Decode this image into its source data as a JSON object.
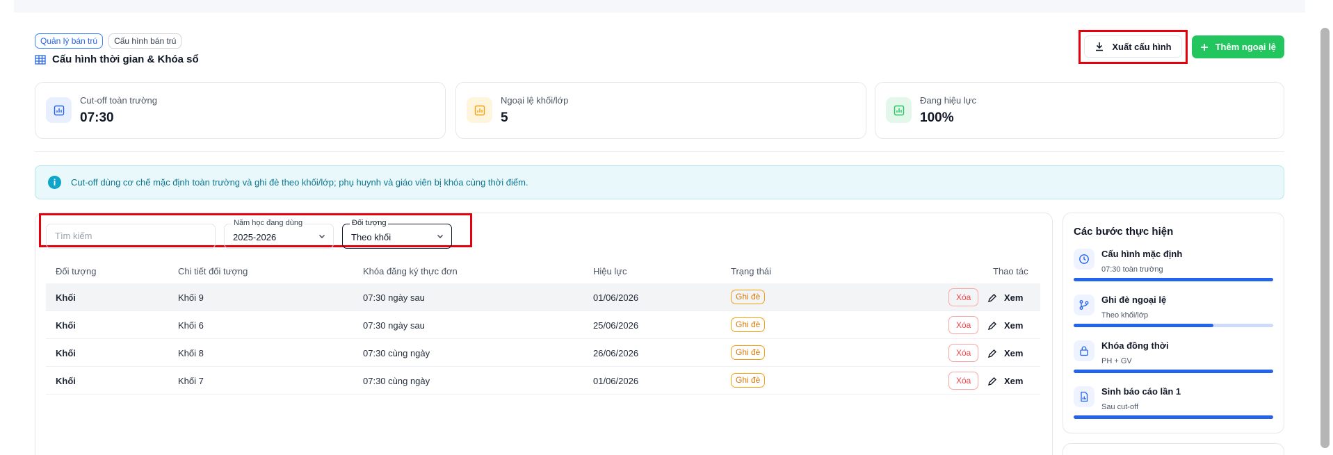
{
  "breadcrumbs": [
    "Quản lý bán trú",
    "Cấu hình bán trú"
  ],
  "page_title": "Cấu hình thời gian & Khóa sổ",
  "actions": {
    "export_label": "Xuất cấu hình",
    "add_label": "Thêm ngoại lệ"
  },
  "stats": [
    {
      "label": "Cut-off toàn trường",
      "value": "07:30",
      "icon": "chart-icon",
      "color": "#2563eb",
      "bg": "#e8efff"
    },
    {
      "label": "Ngoại lệ khối/lớp",
      "value": "5",
      "icon": "chart-icon",
      "color": "#f59e0b",
      "bg": "#fff5dc"
    },
    {
      "label": "Đang hiệu lực",
      "value": "100%",
      "icon": "chart-icon",
      "color": "#22c55e",
      "bg": "#e3f8ea"
    }
  ],
  "info_text": "Cut-off dùng cơ chế mặc định toàn trường và ghi đè theo khối/lớp; phụ huynh và giáo viên bị khóa cùng thời điểm.",
  "filters": {
    "search_placeholder": "Tìm kiếm",
    "year_label": "Năm học đang dùng",
    "year_value": "2025-2026",
    "target_label": "Đối tượng",
    "target_value": "Theo khối"
  },
  "table": {
    "headers": [
      "Đối tượng",
      "Chi tiết đối tượng",
      "Khóa đăng ký thực đơn",
      "Hiệu lực",
      "Trạng thái",
      "Thao tác"
    ],
    "rows": [
      {
        "target": "Khối",
        "detail": "Khối 9",
        "lock": "07:30 ngày sau",
        "effective": "01/06/2026",
        "status": "Ghi đè"
      },
      {
        "target": "Khối",
        "detail": "Khối 6",
        "lock": "07:30 ngày sau",
        "effective": "25/06/2026",
        "status": "Ghi đè"
      },
      {
        "target": "Khối",
        "detail": "Khối 8",
        "lock": "07:30 cùng ngày",
        "effective": "26/06/2026",
        "status": "Ghi đè"
      },
      {
        "target": "Khối",
        "detail": "Khối 7",
        "lock": "07:30 cùng ngày",
        "effective": "01/06/2026",
        "status": "Ghi đè"
      }
    ],
    "delete_label": "Xóa",
    "view_label": "Xem"
  },
  "steps": {
    "title": "Các bước thực hiện",
    "items": [
      {
        "name": "Cấu hình mặc định",
        "sub": "07:30 toàn trường",
        "icon": "clock-icon",
        "progress": 1.0
      },
      {
        "name": "Ghi đè ngoại lệ",
        "sub": "Theo khối/lớp",
        "icon": "branch-icon",
        "progress": 0.7
      },
      {
        "name": "Khóa đồng thời",
        "sub": "PH + GV",
        "icon": "lock-icon",
        "progress": 1.0
      },
      {
        "name": "Sinh báo cáo lần 1",
        "sub": "Sau cut-off",
        "icon": "report-icon",
        "progress": 1.0
      }
    ]
  }
}
